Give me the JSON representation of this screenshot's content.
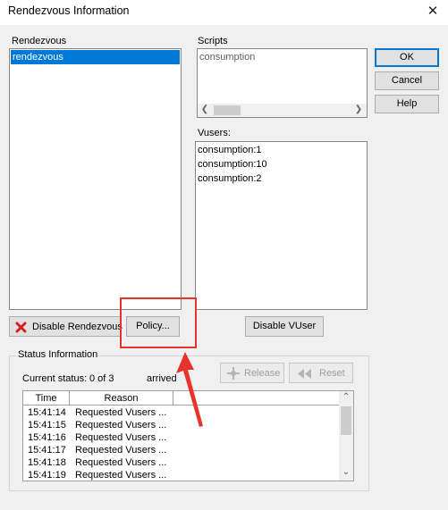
{
  "window": {
    "title": "Rendezvous Information",
    "close_glyph": "✕"
  },
  "rendezvous": {
    "label": "Rendezvous",
    "items": [
      "rendezvous"
    ]
  },
  "scripts": {
    "label": "Scripts",
    "items": [
      "consumption"
    ]
  },
  "vusers": {
    "label": "Vusers:",
    "items": [
      "consumption:1",
      "consumption:10",
      "consumption:2"
    ]
  },
  "buttons": {
    "ok": "OK",
    "cancel": "Cancel",
    "help": "Help",
    "disable_rendezvous": "Disable Rendezvous",
    "policy": "Policy...",
    "disable_vuser": "Disable VUser",
    "release": "Release",
    "reset": "Reset"
  },
  "status": {
    "group_label": "Status Information",
    "current_status_label": "Current status:",
    "current_status_value": "0 of 3",
    "arrived_label": "arrived",
    "columns": [
      "Time",
      "Reason"
    ],
    "rows": [
      {
        "time": "15:41:14",
        "reason": "Requested Vusers ..."
      },
      {
        "time": "15:41:15",
        "reason": "Requested Vusers ..."
      },
      {
        "time": "15:41:16",
        "reason": "Requested Vusers ..."
      },
      {
        "time": "15:41:17",
        "reason": "Requested Vusers ..."
      },
      {
        "time": "15:41:18",
        "reason": "Requested Vusers ..."
      },
      {
        "time": "15:41:19",
        "reason": "Requested Vusers ..."
      }
    ]
  },
  "colors": {
    "selection": "#0078d7",
    "annotation": "#e8322c"
  },
  "icons": {
    "disable_rendezvous": "red-x-icon",
    "release": "release-icon",
    "reset": "rewind-icon",
    "annotation": "red-arrow-icon"
  }
}
